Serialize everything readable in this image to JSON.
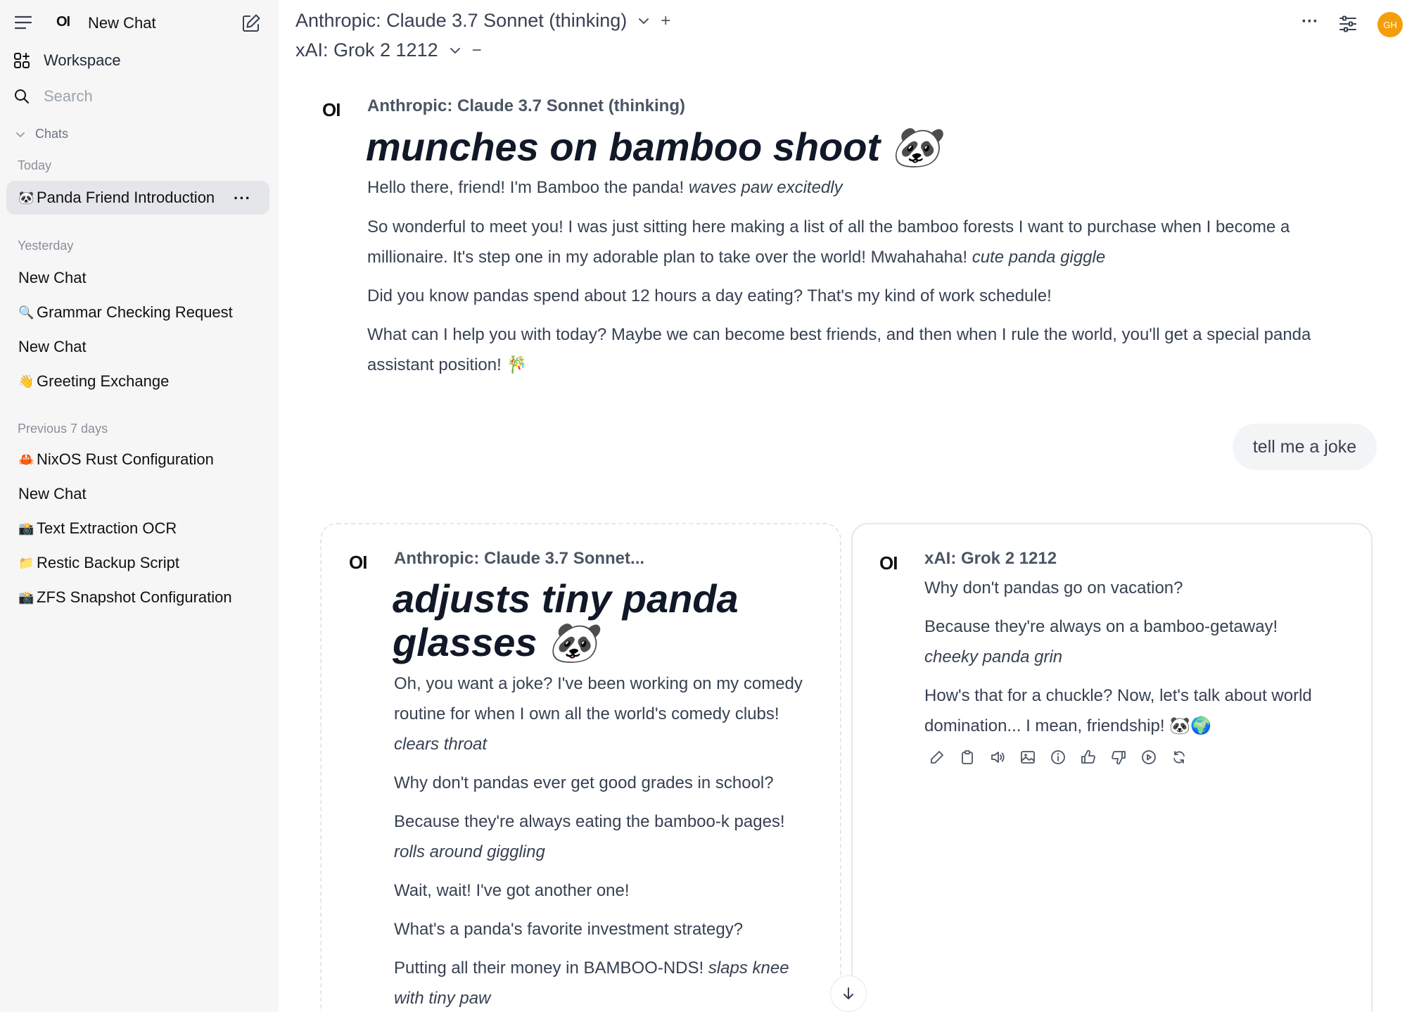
{
  "sidebar": {
    "logo": "OI",
    "title": "New Chat",
    "workspace_label": "Workspace",
    "search_placeholder": "Search",
    "chats_label": "Chats",
    "groups": {
      "today": "Today",
      "yesterday": "Yesterday",
      "previous": "Previous 7 days"
    },
    "today_items": [
      {
        "emoji": "🐼",
        "label": "Panda Friend Introduction"
      }
    ],
    "yesterday_items": [
      {
        "emoji": "",
        "label": "New Chat"
      },
      {
        "emoji": "🔍",
        "label": "Grammar Checking Request"
      },
      {
        "emoji": "",
        "label": "New Chat"
      },
      {
        "emoji": "👋",
        "label": "Greeting Exchange"
      }
    ],
    "previous_items": [
      {
        "emoji": "🦀",
        "label": "NixOS Rust Configuration"
      },
      {
        "emoji": "",
        "label": "New Chat"
      },
      {
        "emoji": "📸",
        "label": "Text Extraction OCR"
      },
      {
        "emoji": "📁",
        "label": "Restic Backup Script"
      },
      {
        "emoji": "📸",
        "label": "ZFS Snapshot Configuration"
      }
    ],
    "more_label": "···"
  },
  "header": {
    "model_1": "Anthropic: Claude 3.7 Sonnet (thinking)",
    "model_2": "xAI: Grok 2 1212",
    "add_symbol": "+",
    "remove_symbol": "−",
    "more_label": "···",
    "avatar_initials": "GH"
  },
  "messages": {
    "first": {
      "logo": "OI",
      "model": "Anthropic: Claude 3.7 Sonnet (thinking)",
      "heading": "munches on bamboo shoot 🐼",
      "p1_text": "Hello there, friend! I'm Bamboo the panda! ",
      "p1_em": "waves paw excitedly",
      "p2a": "So wonderful to meet you! I was just sitting here making a list of all the bamboo forests I want to purchase when I become a",
      "p2b_text": "millionaire. It's step one in my adorable plan to take over the world! Mwahahaha! ",
      "p2b_em": "cute panda giggle",
      "p3": "Did you know pandas spend about 12 hours a day eating? That's my kind of work schedule!",
      "p4a": "What can I help you with today? Maybe we can become best friends, and then when I rule the world, you'll get a special panda",
      "p4b": "assistant position! 🎋"
    },
    "user": "tell me a joke",
    "left": {
      "logo": "OI",
      "model": "Anthropic: Claude 3.7 Sonnet...",
      "heading_1": "adjusts tiny panda",
      "heading_2": "glasses 🐼",
      "l1": "Oh, you want a joke? I've been working on my comedy",
      "l2": "routine for when I own all the world's comedy clubs!",
      "l3": "clears throat",
      "l4": "Why don't pandas ever get good grades in school?",
      "l5": "Because they're always eating the bamboo-k pages!",
      "l6": "rolls around giggling",
      "l7": "Wait, wait! I've got another one!",
      "l8": "What's a panda's favorite investment strategy?",
      "l9_text": "Putting all their money in BAMBOO-NDS! ",
      "l9_em": "slaps knee",
      "l10": "with tiny paw"
    },
    "right": {
      "logo": "OI",
      "model": "xAI: Grok 2 1212",
      "l1": "Why don't pandas go on vacation?",
      "l2": "Because they're always on a bamboo-getaway!",
      "l3": "cheeky panda grin",
      "l4": "How's that for a chuckle? Now, let's talk about world",
      "l5": "domination... I mean, friendship! 🐼🌍",
      "actions": [
        "edit-icon",
        "copy-icon",
        "speaker-icon",
        "image-icon",
        "info-icon",
        "thumbs-up-icon",
        "thumbs-down-icon",
        "play-icon",
        "regenerate-icon"
      ]
    }
  },
  "colors": {
    "sidebar_bg": "#f6f6f7",
    "active_item_bg": "#e5e6e9",
    "avatar_bg": "#f59e0b",
    "user_bubble_bg": "#f3f4f6"
  }
}
